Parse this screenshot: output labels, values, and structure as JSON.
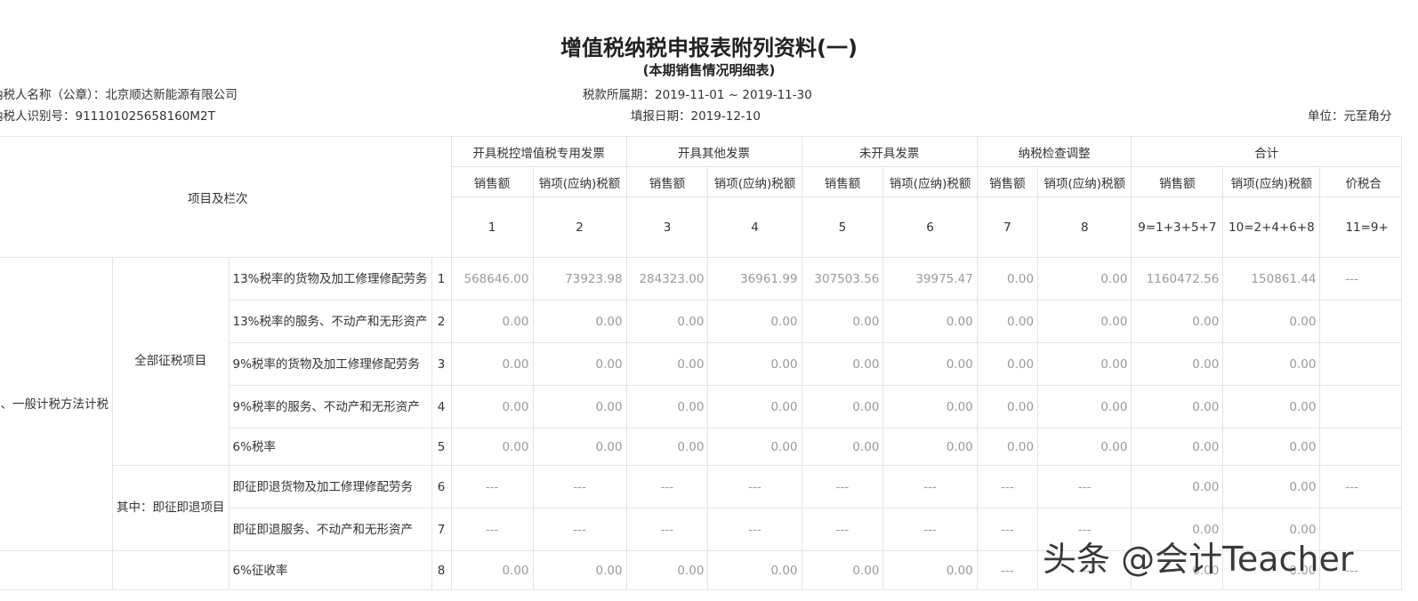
{
  "form": {
    "title": "增值税纳税申报表附列资料(一)",
    "subtitle": "(本期销售情况明细表)",
    "taxpayer_name_label": "纳税人名称（公章）：",
    "taxpayer_name": "北京顺达新能源有限公司",
    "taxpayer_id_label": "纳税人识别号：",
    "taxpayer_id": "911101025658160M2T",
    "period_label": "税款所属期：",
    "period": "2019-11-01 ~ 2019-11-30",
    "fill_date_label": "填报日期：",
    "fill_date": "2019-12-10",
    "unit": "单位：元至角分"
  },
  "table": {
    "corner_label": "项目及栏次",
    "groups": [
      "开具税控增值税专用发票",
      "开具其他发票",
      "未开具发票",
      "纳税检查调整",
      "合计"
    ],
    "sub_headers": [
      "销售额",
      "销项(应纳)税额",
      "销售额",
      "销项(应纳)税额",
      "销售额",
      "销项(应纳)税额",
      "销售额",
      "销项(应纳)税额",
      "销售额",
      "销项(应纳)税额",
      "价税合"
    ],
    "column_numbers": [
      "1",
      "2",
      "3",
      "4",
      "5",
      "6",
      "7",
      "8",
      "9=1+3+5+7",
      "10=2+4+6+8",
      "11=9+"
    ],
    "section_general": "一、一般计税方法计税",
    "category_all": "全部征税项目",
    "category_refund": "其中：即征即退项目",
    "rows": [
      {
        "label": "13%税率的货物及加工修理修配劳务",
        "no": "1",
        "values": [
          "568646.00",
          "73923.98",
          "284323.00",
          "36961.99",
          "307503.56",
          "39975.47",
          "0.00",
          "0.00",
          "1160472.56",
          "150861.44",
          "---"
        ]
      },
      {
        "label": "13%税率的服务、不动产和无形资产",
        "no": "2",
        "values": [
          "0.00",
          "0.00",
          "0.00",
          "0.00",
          "0.00",
          "0.00",
          "0.00",
          "0.00",
          "0.00",
          "0.00",
          ""
        ]
      },
      {
        "label": "9%税率的货物及加工修理修配劳务",
        "no": "3",
        "values": [
          "0.00",
          "0.00",
          "0.00",
          "0.00",
          "0.00",
          "0.00",
          "0.00",
          "0.00",
          "0.00",
          "0.00",
          ""
        ]
      },
      {
        "label": "9%税率的服务、不动产和无形资产",
        "no": "4",
        "values": [
          "0.00",
          "0.00",
          "0.00",
          "0.00",
          "0.00",
          "0.00",
          "0.00",
          "0.00",
          "0.00",
          "0.00",
          ""
        ]
      },
      {
        "label": "6%税率",
        "no": "5",
        "values": [
          "0.00",
          "0.00",
          "0.00",
          "0.00",
          "0.00",
          "0.00",
          "0.00",
          "0.00",
          "0.00",
          "0.00",
          ""
        ]
      },
      {
        "label": "即征即退货物及加工修理修配劳务",
        "no": "6",
        "values": [
          "---",
          "---",
          "---",
          "---",
          "---",
          "---",
          "---",
          "---",
          "0.00",
          "0.00",
          "---"
        ]
      },
      {
        "label": "即征即退服务、不动产和无形资产",
        "no": "7",
        "values": [
          "---",
          "---",
          "---",
          "---",
          "---",
          "---",
          "---",
          "---",
          "0.00",
          "0.00",
          ""
        ]
      },
      {
        "label": "6%征收率",
        "no": "8",
        "values": [
          "0.00",
          "0.00",
          "0.00",
          "0.00",
          "0.00",
          "0.00",
          "---",
          "---",
          "0.00",
          "0.00",
          "---"
        ]
      }
    ]
  },
  "watermark": "头条 @会计Teacher"
}
